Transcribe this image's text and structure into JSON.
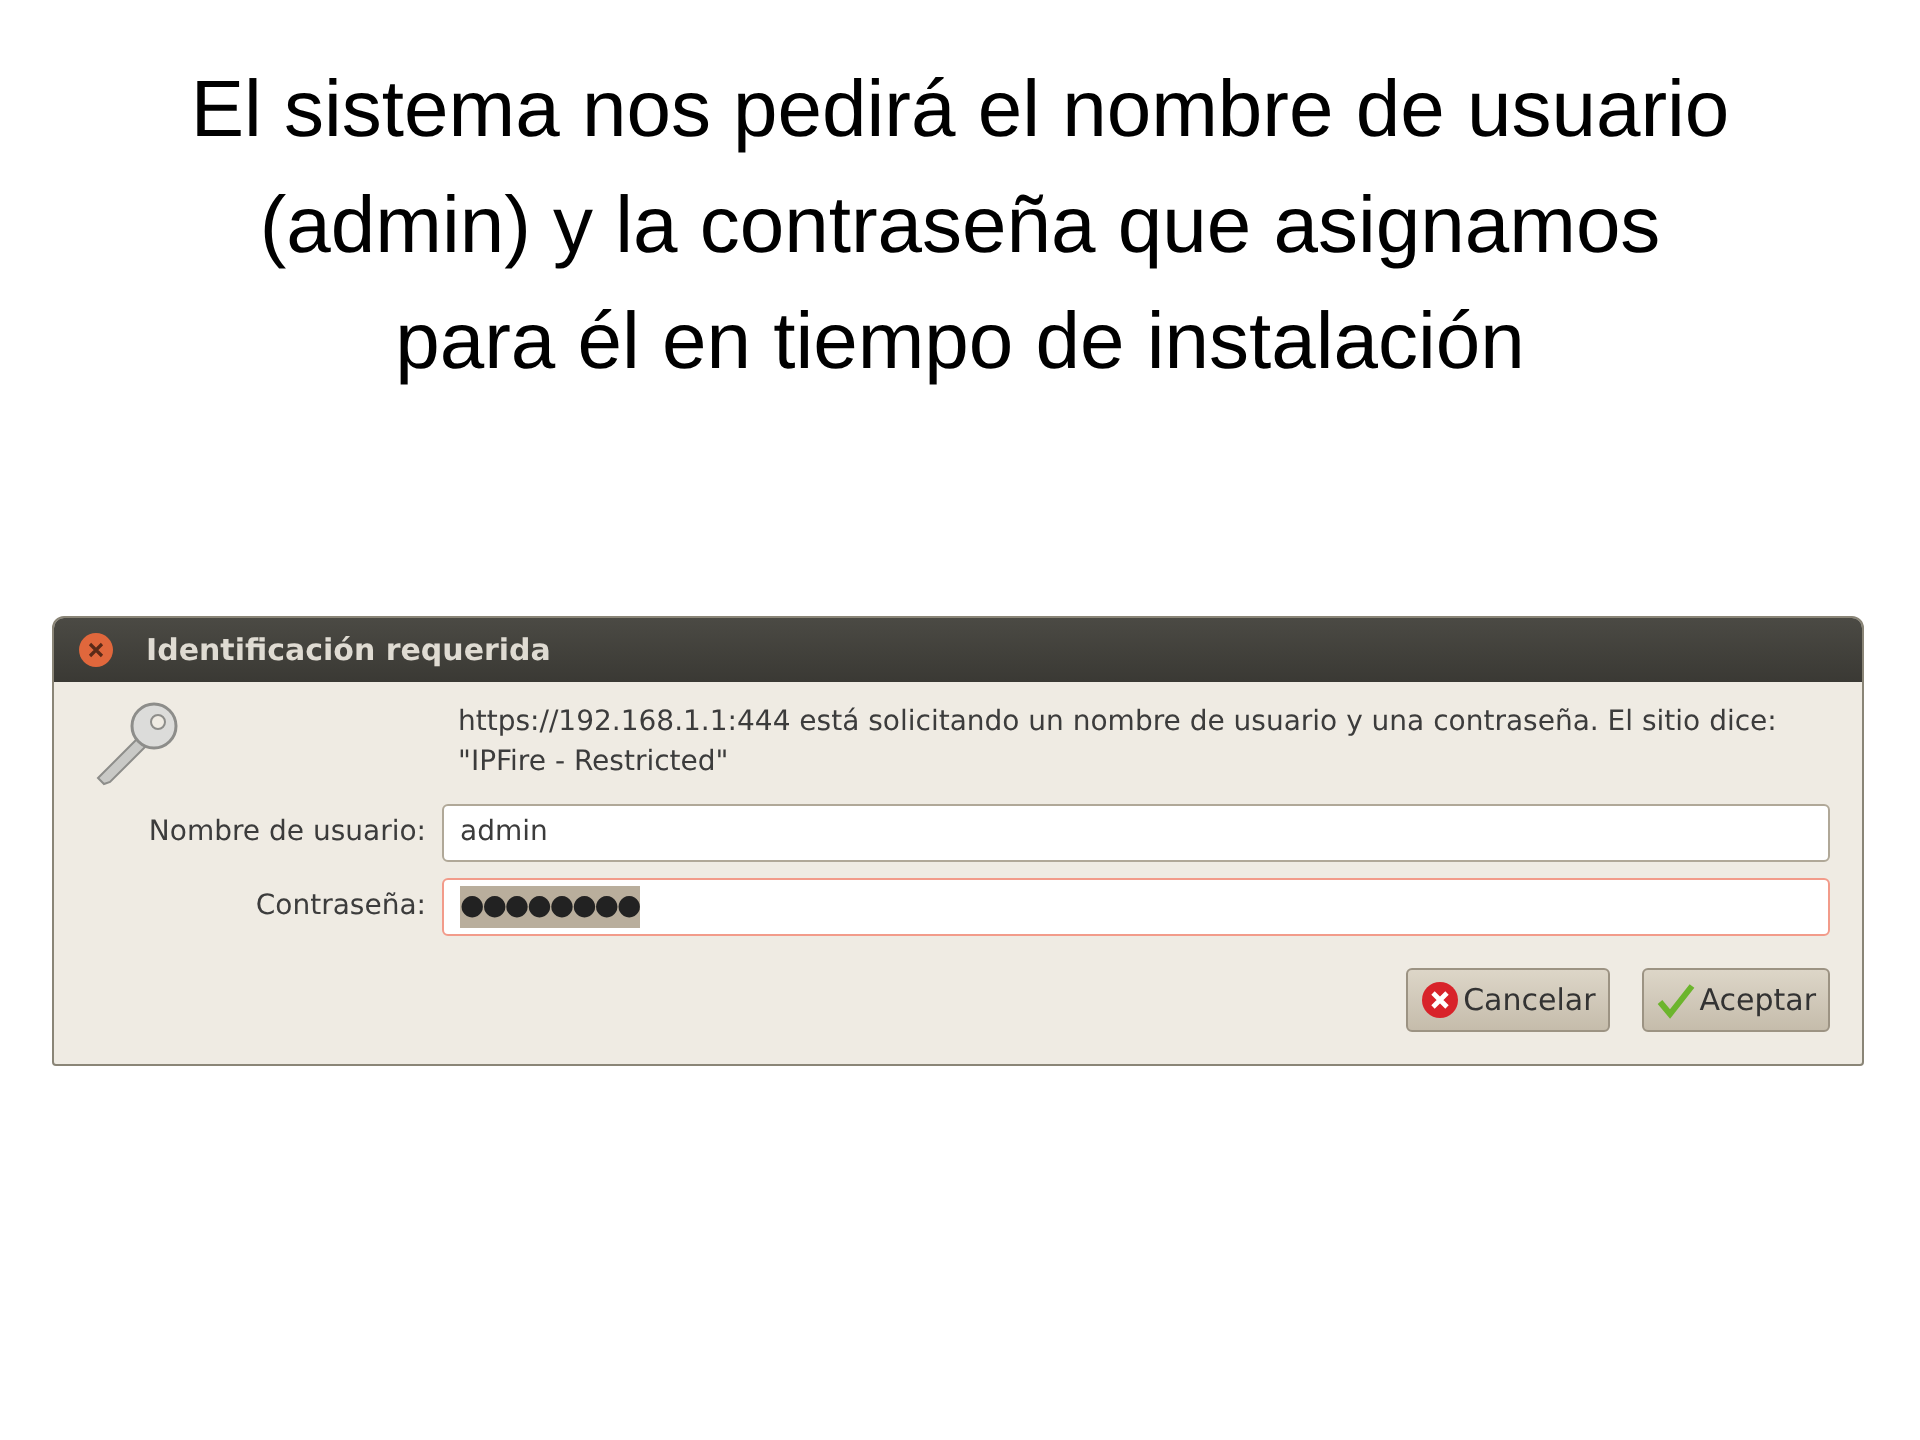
{
  "slide": {
    "title": "El sistema nos pedirá el nombre de usuario (admin) y la contraseña que asignamos para él en tiempo de instalación"
  },
  "dialog": {
    "title": "Identificación requerida",
    "message": "https://192.168.1.1:444 está solicitando un nombre de usuario y una contraseña. El sitio dice: \"IPFire - Restricted\"",
    "fields": [
      {
        "label": "Nombre de usuario:",
        "value": "admin",
        "kind": "text",
        "focused": false
      },
      {
        "label": "Contraseña:",
        "value": "●●●●●●●●",
        "kind": "password",
        "focused": true
      }
    ],
    "buttons": [
      {
        "label": "Cancelar",
        "kind": "cancel"
      },
      {
        "label": "Aceptar",
        "kind": "ok"
      }
    ]
  }
}
